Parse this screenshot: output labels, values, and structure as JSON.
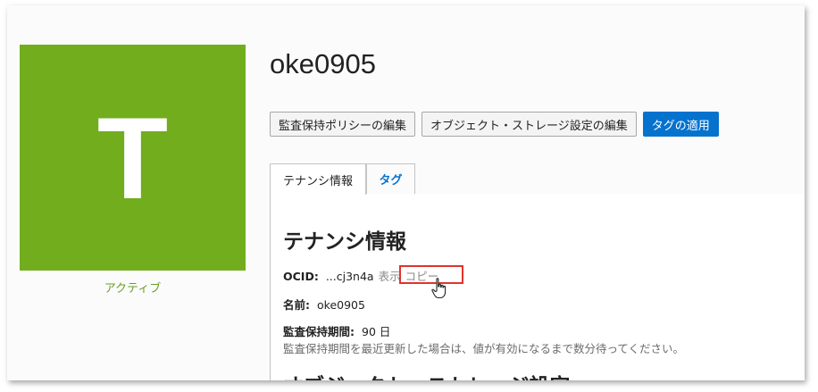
{
  "tenancy": {
    "name": "oke0905",
    "avatar_letter": "T",
    "status": "アクティブ",
    "status_color": "#6a9e2a",
    "avatar_color": "#72ad1e"
  },
  "actions": {
    "edit_audit_policy": "監査保持ポリシーの編集",
    "edit_object_storage": "オブジェクト・ストレージ設定の編集",
    "apply_tags": "タグの適用",
    "primary_color": "#0572ce"
  },
  "tabs": [
    {
      "label": "テナンシ情報",
      "active": true
    },
    {
      "label": "タグ",
      "active": false
    }
  ],
  "details": {
    "section_title": "テナンシ情報",
    "ocid_label": "OCID:",
    "ocid_value": "...cj3n4a",
    "show_link": "表示",
    "copy_link": "コピー",
    "name_label": "名前:",
    "name_value": "oke0905",
    "retention_label": "監査保持期間:",
    "retention_value": "90 日",
    "retention_hint": "監査保持期間を最近更新した場合は、値が有効になるまで数分待ってください。",
    "next_section_title": "オブジェクト・ストレージ設定"
  },
  "icons": {
    "cursor": "hand-pointer-icon"
  }
}
